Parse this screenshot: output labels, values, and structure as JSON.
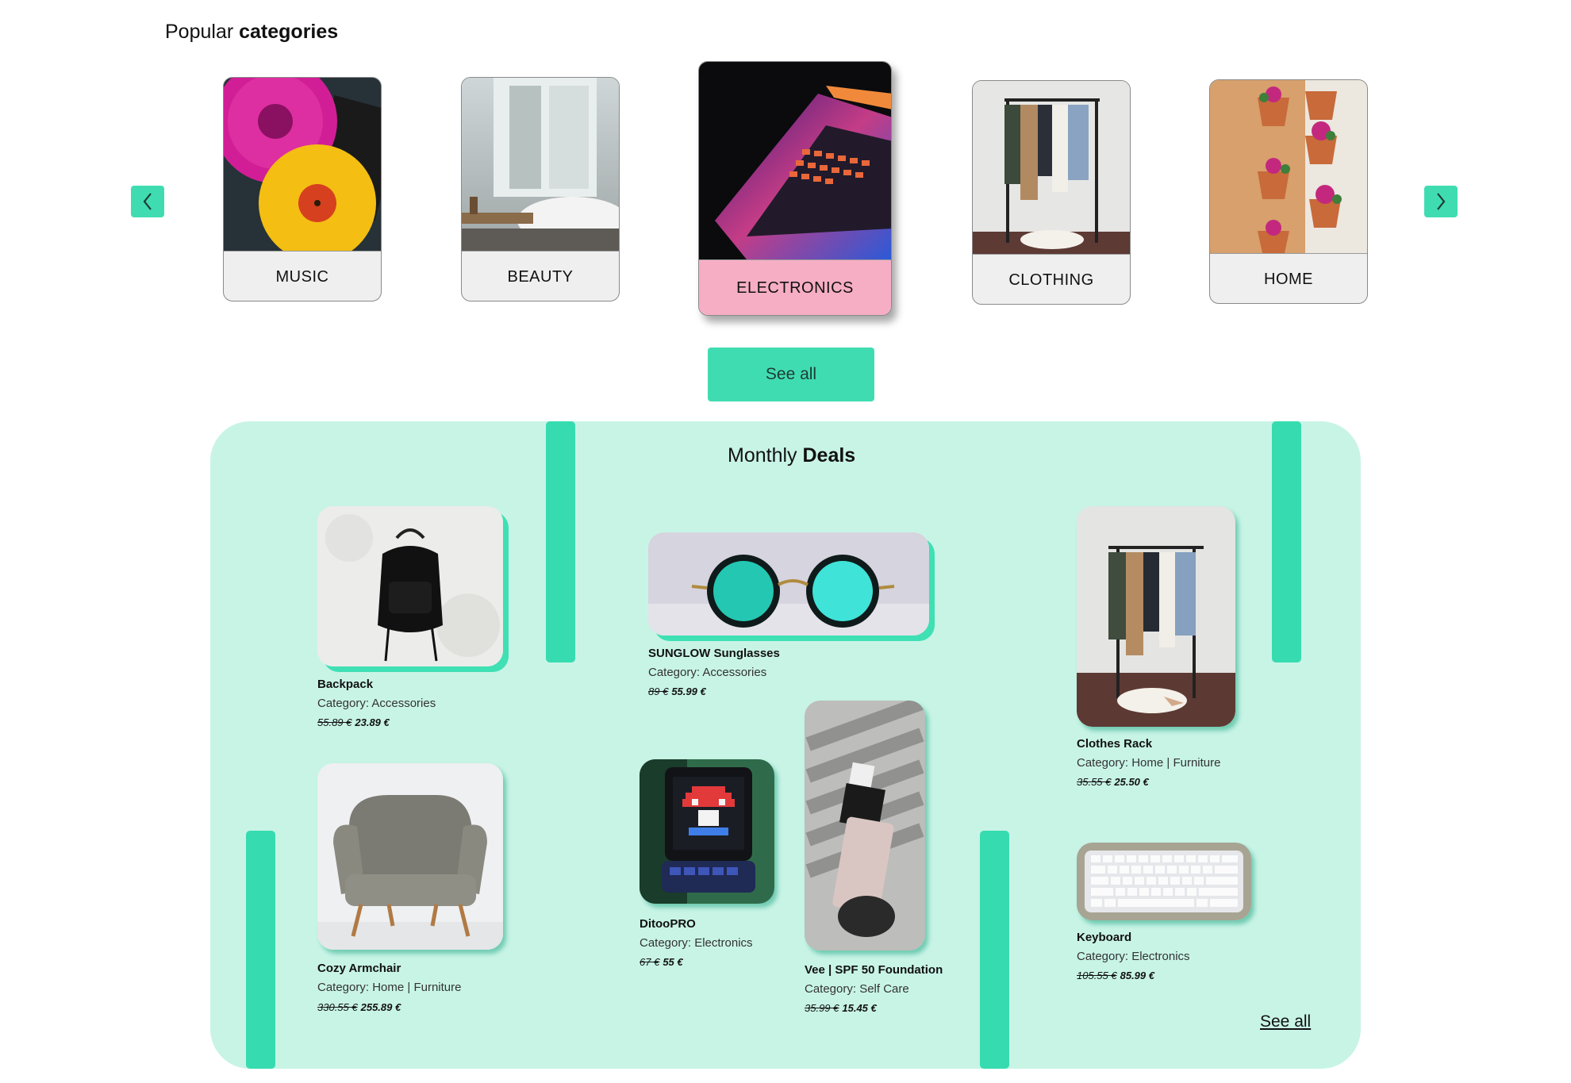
{
  "popular": {
    "title_regular": "Popular ",
    "title_bold": "categories",
    "prev_icon": "chevron-left-icon",
    "next_icon": "chevron-right-icon",
    "categories": [
      {
        "label": "MUSIC"
      },
      {
        "label": "BEAUTY"
      },
      {
        "label": "ELECTRONICS",
        "active": true
      },
      {
        "label": "CLOTHING"
      },
      {
        "label": "HOME"
      }
    ],
    "see_all": "See all"
  },
  "deals": {
    "title_regular": "Monthly ",
    "title_bold": "Deals",
    "see_all": "See all",
    "products": [
      {
        "name": "Backpack",
        "category": "Category: Accessories",
        "old_price": "55.89 €",
        "price": "23.89 €"
      },
      {
        "name": "SUNGLOW Sunglasses",
        "category": "Category: Accessories",
        "old_price": "89 €",
        "price": "55.99 €"
      },
      {
        "name": "Clothes Rack",
        "category": "Category: Home | Furniture",
        "old_price": "35.55 €",
        "price": "25.50 €"
      },
      {
        "name": "Cozy Armchair",
        "category": "Category: Home | Furniture",
        "old_price": "330.55 €",
        "price": "255.89 €"
      },
      {
        "name": "DitooPRO",
        "category": "Category: Electronics",
        "old_price": "67 €",
        "price": "55 €"
      },
      {
        "name": "Vee | SPF 50 Foundation",
        "category": "Category: Self Care",
        "old_price": "35.99 €",
        "price": "15.45 €"
      },
      {
        "name": "Keyboard",
        "category": "Category: Electronics",
        "old_price": "105.55 €",
        "price": "85.99 €"
      }
    ]
  },
  "colors": {
    "accent": "#40dcb1",
    "panel": "#c8f4e6",
    "active_label": "#f6aec5"
  }
}
